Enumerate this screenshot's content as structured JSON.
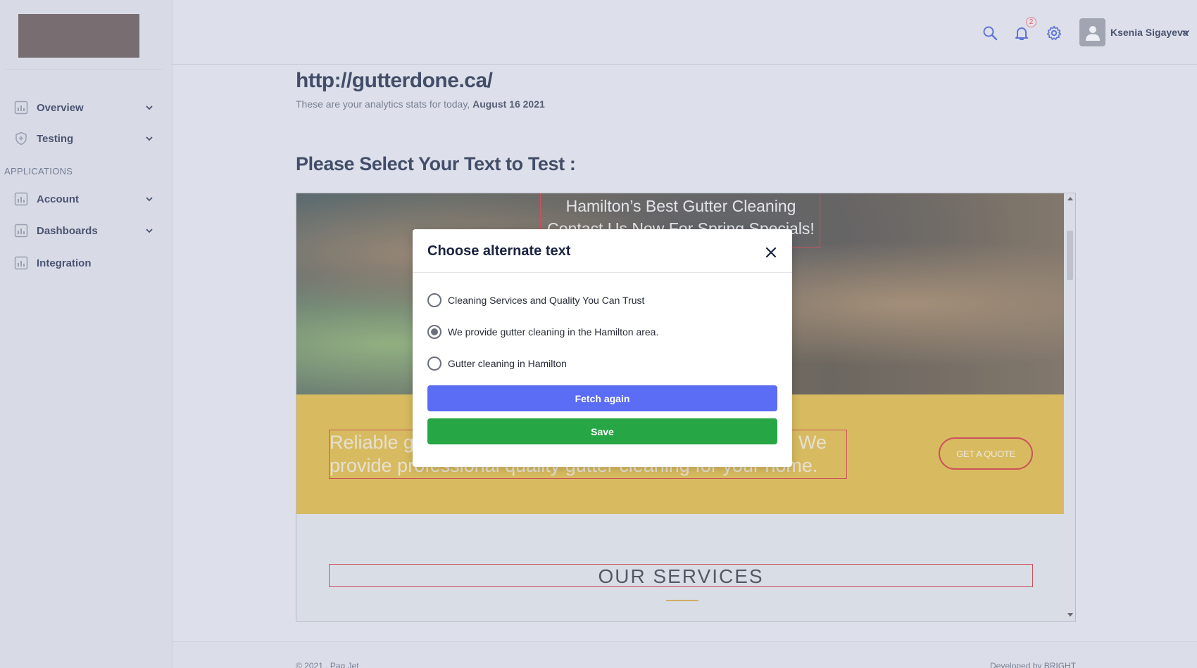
{
  "sidebar": {
    "section_label": "APPLICATIONS",
    "items": [
      {
        "label": "Overview",
        "icon": "bar-chart-icon"
      },
      {
        "label": "Testing",
        "icon": "shield-icon"
      },
      {
        "label": "Account",
        "icon": "bar-chart-icon"
      },
      {
        "label": "Dashboards",
        "icon": "bar-chart-icon"
      },
      {
        "label": "Integration",
        "icon": "bar-chart-icon"
      }
    ]
  },
  "header": {
    "icons": [
      "search-icon",
      "bell-icon",
      "gear-icon"
    ],
    "notification_count": "2",
    "user_name": "Ksenia Sigayeva"
  },
  "main": {
    "site_url": "http://gutterdone.ca/",
    "subtitle_prefix": "These are your analytics stats for today,",
    "subtitle_date": "August 16 2021",
    "section_title": "Please Select Your Text to Test :"
  },
  "preview": {
    "hero_line1": "Hamilton’s Best Gutter Cleaning",
    "hero_line2": "Contact Us Now For Spring Specials!",
    "band_line1_left": "Reliable g",
    "band_line1_right": "We",
    "band_line2": "provide professional quality gutter cleaning for your home.",
    "quote_button": "GET A QUOTE",
    "services_title": "OUR SERVICES"
  },
  "modal": {
    "title": "Choose alternate text",
    "options": [
      {
        "label": "Cleaning Services and Quality You Can Trust",
        "checked": false
      },
      {
        "label": "We provide gutter cleaning in the Hamilton area.",
        "checked": true
      },
      {
        "label": "Gutter cleaning in Hamilton",
        "checked": false
      }
    ],
    "fetch_button": "Fetch again",
    "save_button": "Save"
  },
  "footer": {
    "left": "© 2021 , Pag Jet",
    "right": "Developed by BRIGHT"
  },
  "colors": {
    "accent_blue": "#5b6cf5",
    "save_green": "#27a645",
    "highlight_red": "#d0262e",
    "band_yellow": "#e2b733"
  }
}
